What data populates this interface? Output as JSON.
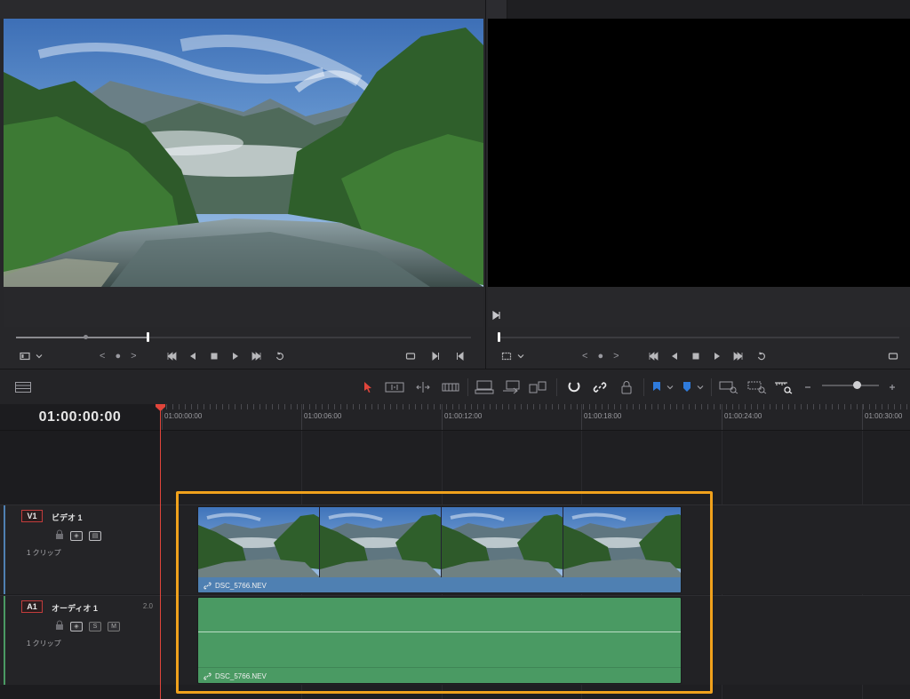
{
  "colors": {
    "accent_selection": "#f0a11c",
    "playhead": "#e0453b",
    "video_clip": "#4f80b2",
    "audio_clip": "#4a9a63",
    "track_badge_border": "#c23c3c",
    "marker_blue": "#2f7bdc"
  },
  "viewer": {
    "left_jog": "< ● >",
    "right_jog": "< ● >"
  },
  "toolbar": {
    "icons": [
      "timeline-layout-icon",
      "selection-arrow-icon",
      "trim-edit-icon",
      "dynamic-trim-icon",
      "blade-icon",
      "insert-clip-icon",
      "overwrite-clip-icon",
      "replace-clip-icon",
      "snapping-icon",
      "linked-selection-icon",
      "position-lock-icon",
      "flag-icon",
      "marker-icon",
      "full-extent-zoom-icon",
      "detail-zoom-icon",
      "custom-zoom-icon"
    ]
  },
  "timeline": {
    "timecode": "01:00:00:00",
    "ruler_labels": [
      "01:00:00:00",
      "01:00:06:00",
      "01:00:12:00",
      "01:00:18:00",
      "01:00:24:00",
      "01:00:30:00"
    ]
  },
  "tracks": {
    "video": {
      "badge": "V1",
      "name": "ビデオ 1",
      "clip_count": "1 クリップ",
      "clip_name": "DSC_5766.NEV"
    },
    "audio": {
      "badge": "A1",
      "name": "オーディオ 1",
      "level": "2.0",
      "clip_count": "1 クリップ",
      "clip_name": "DSC_5766.NEV",
      "solo_label": "S",
      "mute_label": "M"
    }
  }
}
